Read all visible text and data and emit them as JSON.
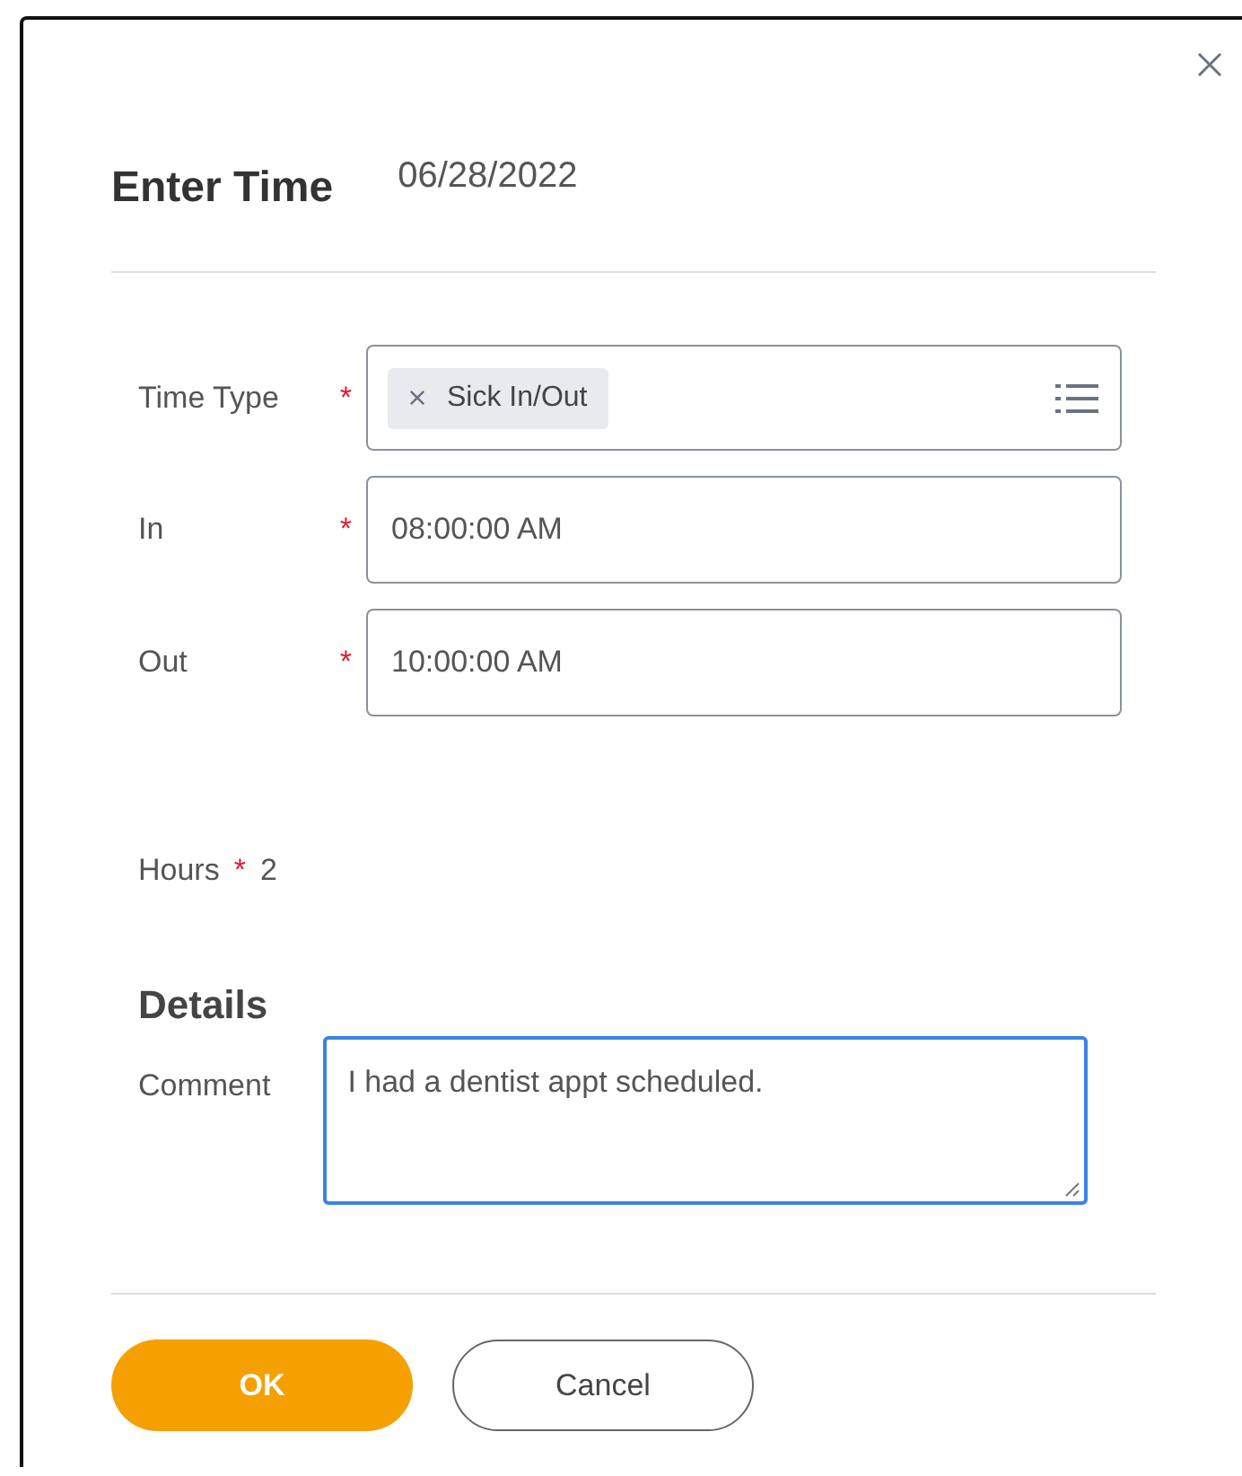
{
  "dialog": {
    "title": "Enter Time",
    "date": "06/28/2022"
  },
  "fields": [
    {
      "label": "Time Type",
      "required_mark": "*",
      "kind": "chip",
      "value": "Sick In/Out"
    },
    {
      "label": "In",
      "required_mark": "*",
      "kind": "text",
      "value": "08:00:00 AM"
    },
    {
      "label": "Out",
      "required_mark": "*",
      "kind": "text",
      "value": "10:00:00 AM"
    }
  ],
  "hours": {
    "label": "Hours",
    "required_mark": "*",
    "value": "2"
  },
  "details": {
    "heading": "Details",
    "comment_label": "Comment",
    "comment": "I had a dentist appt scheduled.",
    "focused": true
  },
  "buttons": [
    {
      "label": "OK",
      "kind": "primary"
    },
    {
      "label": "Cancel",
      "kind": "secondary"
    }
  ]
}
